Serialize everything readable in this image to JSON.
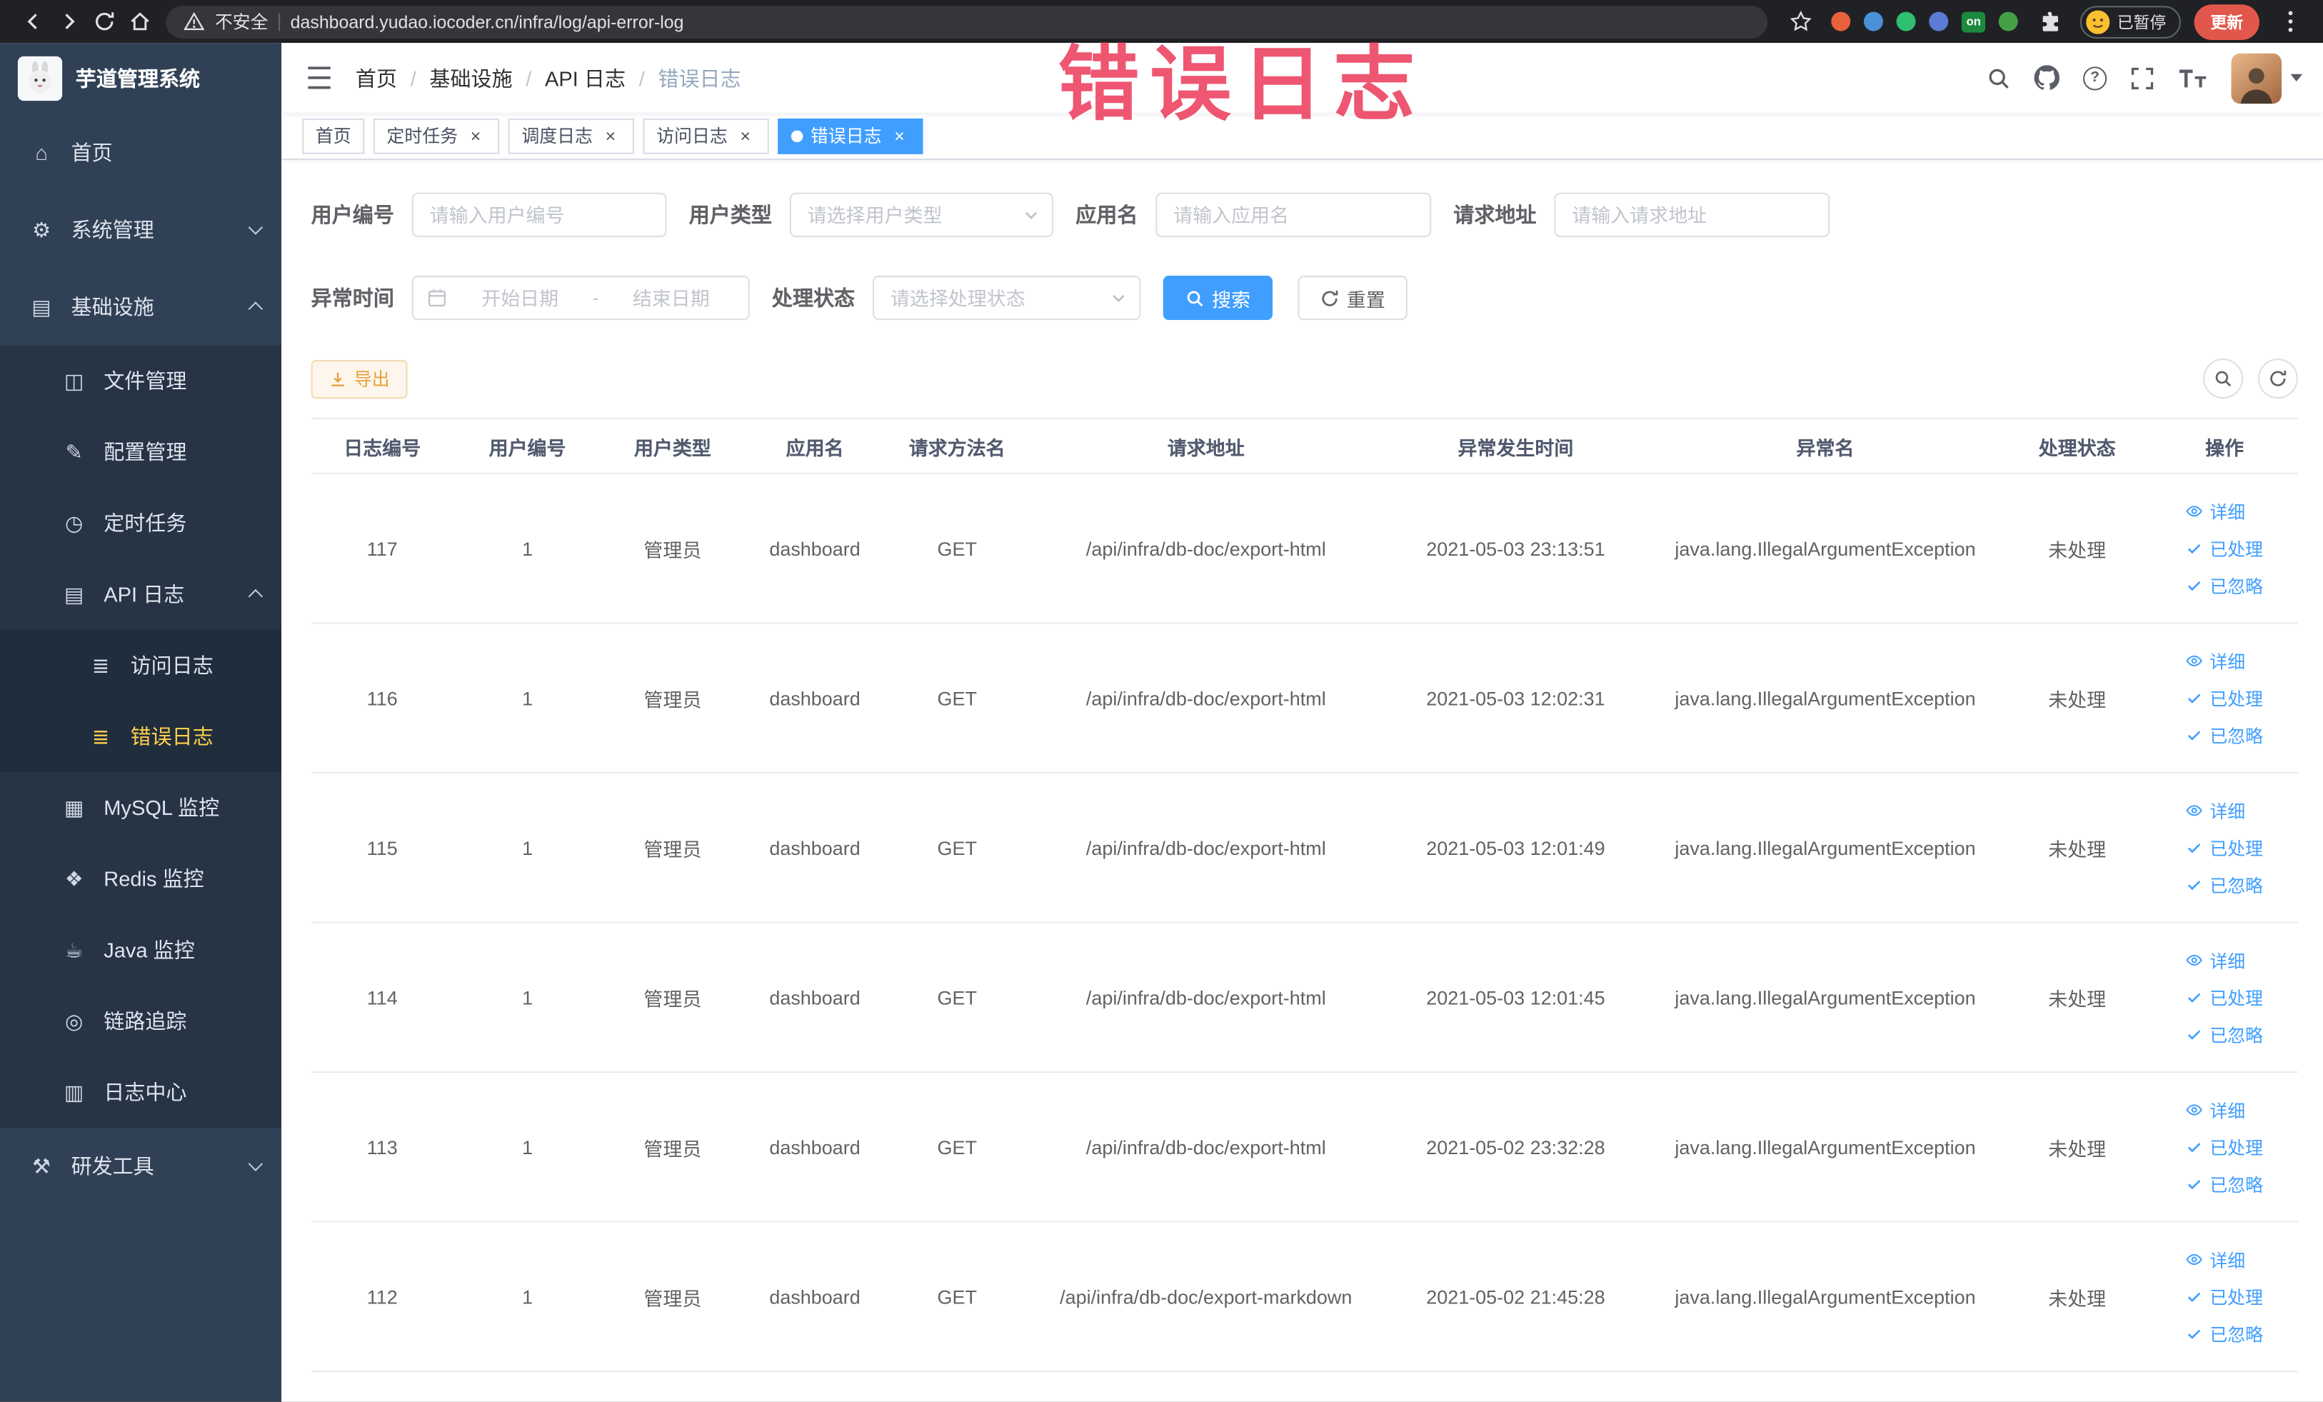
{
  "browser": {
    "security_label": "不安全",
    "url": "dashboard.yudao.iocoder.cn/infra/log/api-error-log",
    "profile_status": "已暂停",
    "update_label": "更新",
    "extension_badge_label": "on",
    "extension_colors": [
      "#e8613c",
      "#4a90d9",
      "#2fbf71",
      "#5b7bd5",
      "badge",
      "#43a047"
    ]
  },
  "watermark": "错误日志",
  "sidebar": {
    "logo_title": "芋道管理系统",
    "menu": [
      {
        "key": "home",
        "label": "首页",
        "icon": "home",
        "level": 1
      },
      {
        "key": "system-mgmt",
        "label": "系统管理",
        "icon": "gear",
        "level": 1,
        "arrow": "down"
      },
      {
        "key": "infrastructure",
        "label": "基础设施",
        "icon": "infra",
        "level": 1,
        "arrow": "up"
      },
      {
        "key": "file-mgmt",
        "label": "文件管理",
        "icon": "file",
        "level": 2
      },
      {
        "key": "config-mgmt",
        "label": "配置管理",
        "icon": "config",
        "level": 2
      },
      {
        "key": "scheduled-job",
        "label": "定时任务",
        "icon": "job",
        "level": 2
      },
      {
        "key": "api-log",
        "label": "API 日志",
        "icon": "log",
        "level": 2,
        "arrow": "up"
      },
      {
        "key": "access-log",
        "label": "访问日志",
        "icon": "doc",
        "level": 3
      },
      {
        "key": "error-log",
        "label": "错误日志",
        "icon": "doc",
        "level": 3,
        "active": true
      },
      {
        "key": "mysql-monitor",
        "label": "MySQL 监控",
        "icon": "mysql",
        "level": 2
      },
      {
        "key": "redis-monitor",
        "label": "Redis 监控",
        "icon": "redis",
        "level": 2
      },
      {
        "key": "java-monitor",
        "label": "Java 监控",
        "icon": "java",
        "level": 2
      },
      {
        "key": "trace",
        "label": "链路追踪",
        "icon": "trace",
        "level": 2
      },
      {
        "key": "log-center",
        "label": "日志中心",
        "icon": "logcenter",
        "level": 2
      },
      {
        "key": "dev-tools",
        "label": "研发工具",
        "icon": "tool",
        "level": 1,
        "arrow": "down"
      }
    ]
  },
  "navbar": {
    "breadcrumb": [
      "首页",
      "基础设施",
      "API 日志",
      "错误日志"
    ]
  },
  "tabs": [
    {
      "key": "home",
      "label": "首页",
      "closable": false,
      "active": false
    },
    {
      "key": "job",
      "label": "定时任务",
      "closable": true,
      "active": false
    },
    {
      "key": "job-log",
      "label": "调度日志",
      "closable": true,
      "active": false
    },
    {
      "key": "access-log",
      "label": "访问日志",
      "closable": true,
      "active": false
    },
    {
      "key": "error-log",
      "label": "错误日志",
      "closable": true,
      "active": true
    }
  ],
  "filters": {
    "user_id": {
      "label": "用户编号",
      "placeholder": "请输入用户编号"
    },
    "user_type": {
      "label": "用户类型",
      "placeholder": "请选择用户类型"
    },
    "app_name": {
      "label": "应用名",
      "placeholder": "请输入应用名"
    },
    "request_url": {
      "label": "请求地址",
      "placeholder": "请输入请求地址"
    },
    "exception_time": {
      "label": "异常时间",
      "start_placeholder": "开始日期",
      "separator": "-",
      "end_placeholder": "结束日期"
    },
    "process_status": {
      "label": "处理状态",
      "placeholder": "请选择处理状态"
    },
    "search_label": "搜索",
    "reset_label": "重置"
  },
  "toolbar": {
    "export_label": "导出"
  },
  "table": {
    "headers": [
      "日志编号",
      "用户编号",
      "用户类型",
      "应用名",
      "请求方法名",
      "请求地址",
      "异常发生时间",
      "异常名",
      "处理状态",
      "操作"
    ],
    "action_labels": [
      "详细",
      "已处理",
      "已忽略"
    ],
    "rows": [
      {
        "log_id": "117",
        "user_id": "1",
        "user_type": "管理员",
        "app_name": "dashboard",
        "method": "GET",
        "url": "/api/infra/db-doc/export-html",
        "time": "2021-05-03 23:13:51",
        "exception": "java.lang.IllegalArgumentException",
        "status": "未处理"
      },
      {
        "log_id": "116",
        "user_id": "1",
        "user_type": "管理员",
        "app_name": "dashboard",
        "method": "GET",
        "url": "/api/infra/db-doc/export-html",
        "time": "2021-05-03 12:02:31",
        "exception": "java.lang.IllegalArgumentException",
        "status": "未处理"
      },
      {
        "log_id": "115",
        "user_id": "1",
        "user_type": "管理员",
        "app_name": "dashboard",
        "method": "GET",
        "url": "/api/infra/db-doc/export-html",
        "time": "2021-05-03 12:01:49",
        "exception": "java.lang.IllegalArgumentException",
        "status": "未处理"
      },
      {
        "log_id": "114",
        "user_id": "1",
        "user_type": "管理员",
        "app_name": "dashboard",
        "method": "GET",
        "url": "/api/infra/db-doc/export-html",
        "time": "2021-05-03 12:01:45",
        "exception": "java.lang.IllegalArgumentException",
        "status": "未处理"
      },
      {
        "log_id": "113",
        "user_id": "1",
        "user_type": "管理员",
        "app_name": "dashboard",
        "method": "GET",
        "url": "/api/infra/db-doc/export-html",
        "time": "2021-05-02 23:32:28",
        "exception": "java.lang.IllegalArgumentException",
        "status": "未处理"
      },
      {
        "log_id": "112",
        "user_id": "1",
        "user_type": "管理员",
        "app_name": "dashboard",
        "method": "GET",
        "url": "/api/infra/db-doc/export-markdown",
        "time": "2021-05-02 21:45:28",
        "exception": "java.lang.IllegalArgumentException",
        "status": "未处理"
      }
    ]
  },
  "colors": {
    "primary": "#409eff",
    "warning": "#e6a23c",
    "sidebar_bg": "#304156",
    "active_menu": "#ffd04b",
    "watermark": "#ec3f5e"
  }
}
